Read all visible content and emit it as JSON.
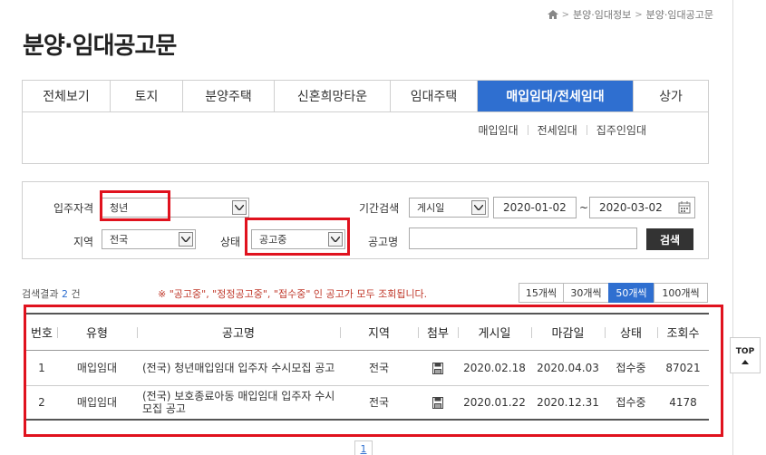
{
  "breadcrumb": {
    "items": [
      "분양·임대정보",
      "분양·임대공고문"
    ]
  },
  "page_title": "분양·임대공고문",
  "tabs": [
    {
      "label": "전체보기"
    },
    {
      "label": "토지"
    },
    {
      "label": "분양주택"
    },
    {
      "label": "신혼희망타운"
    },
    {
      "label": "임대주택"
    },
    {
      "label": "매입임대/전세임대"
    },
    {
      "label": "상가"
    }
  ],
  "subtabs": [
    "매입임대",
    "전세임대",
    "집주인임대"
  ],
  "search": {
    "resident_label": "입주자격",
    "resident_value": "청년",
    "period_label": "기간검색",
    "period_type": "게시일",
    "date_from": "2020-01-02",
    "date_to": "2020-03-02",
    "tilde": "~",
    "region_label": "지역",
    "region_value": "전국",
    "status_label": "상태",
    "status_value": "공고중",
    "name_label": "공고명",
    "name_value": "",
    "search_button": "검색"
  },
  "results": {
    "count_prefix": "검색결과",
    "count": "2",
    "count_suffix": "건",
    "notice": "※ \"공고중\", \"정정공고중\", \"접수중\" 인 공고가 모두 조회됩니다."
  },
  "per_page": [
    {
      "label": "15개씩",
      "active": false
    },
    {
      "label": "30개씩",
      "active": false
    },
    {
      "label": "50개씩",
      "active": true
    },
    {
      "label": "100개씩",
      "active": false
    }
  ],
  "table": {
    "headers": [
      "번호",
      "유형",
      "공고명",
      "지역",
      "첨부",
      "게시일",
      "마감일",
      "상태",
      "조회수"
    ],
    "rows": [
      {
        "no": "1",
        "type": "매입임대",
        "title": "(전국) 청년매입임대 입주자 수시모집 공고",
        "region": "전국",
        "posted": "2020.02.18",
        "deadline": "2020.04.03",
        "status": "접수중",
        "views": "87021"
      },
      {
        "no": "2",
        "type": "매입임대",
        "title": "(전국) 보호종료아동 매입임대 입주자 수시 모집 공고",
        "region": "전국",
        "posted": "2020.01.22",
        "deadline": "2020.12.31",
        "status": "접수중",
        "views": "4178"
      }
    ]
  },
  "top_button": "TOP",
  "pagination": {
    "current": "1"
  },
  "colors": {
    "accent": "#2f6fd0",
    "highlight": "#e0121e",
    "notice": "#c0392b"
  }
}
